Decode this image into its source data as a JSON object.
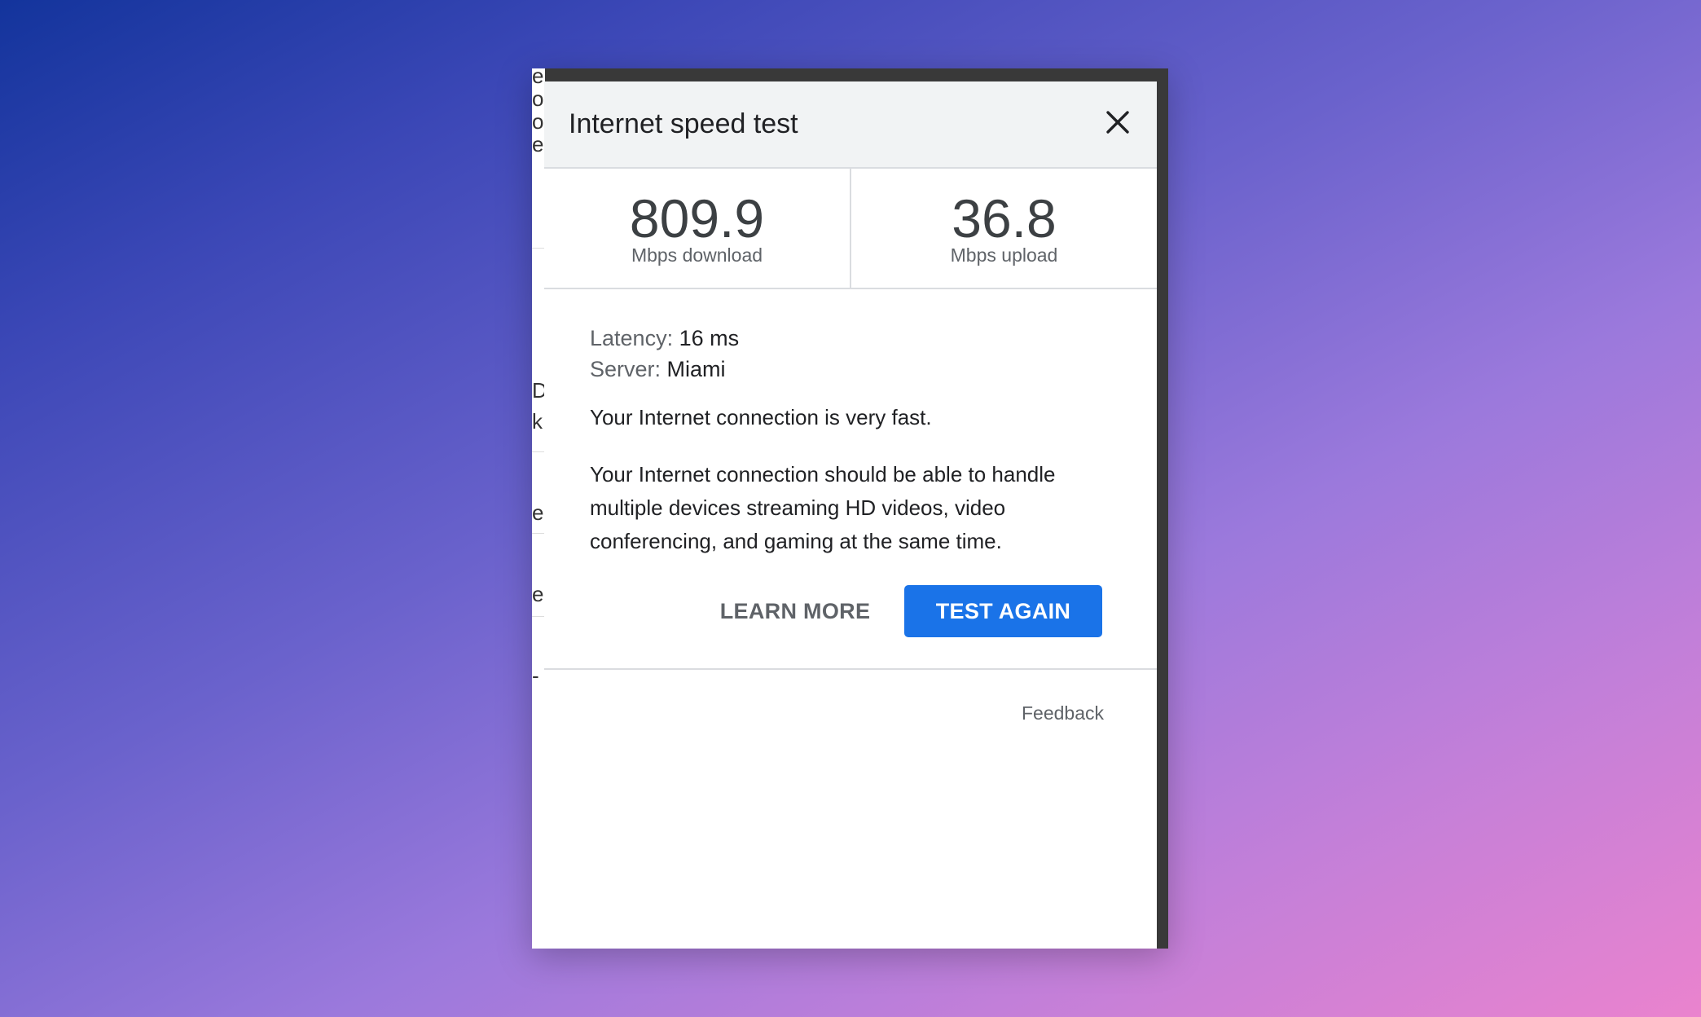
{
  "dialog": {
    "title": "Internet speed test",
    "close_icon": "close-icon"
  },
  "metrics": {
    "download": {
      "value": "809.9",
      "unit": "Mbps download"
    },
    "upload": {
      "value": "36.8",
      "unit": "Mbps upload"
    }
  },
  "details": {
    "latency_label": "Latency:",
    "latency_value": "16 ms",
    "server_label": "Server:",
    "server_value": "Miami"
  },
  "summary": "Your Internet connection is very fast.",
  "description": "Your Internet connection should be able to handle multiple devices streaming HD videos, video conferencing, and gaming at the same time.",
  "actions": {
    "learn_more": "LEARN MORE",
    "test_again": "TEST AGAIN"
  },
  "footer": {
    "feedback": "Feedback"
  },
  "colors": {
    "accent": "#1a73e8",
    "header_bg": "#f1f3f4"
  }
}
